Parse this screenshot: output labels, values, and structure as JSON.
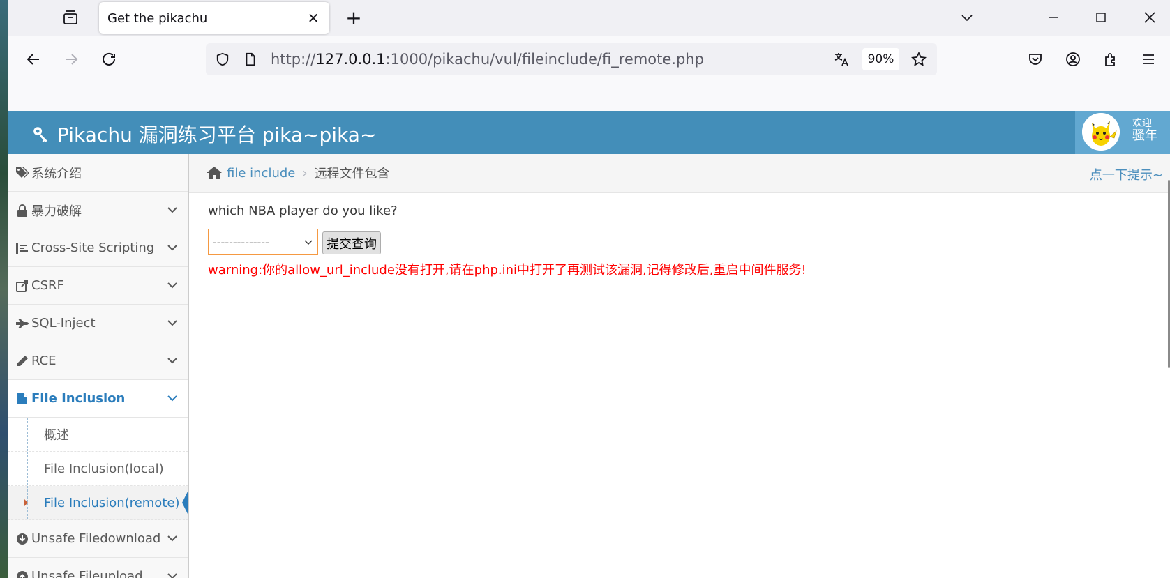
{
  "browser": {
    "tab_title": "Get the pikachu",
    "url_scheme": "http://",
    "url_host": "127.0.0.1",
    "url_path": ":1000/pikachu/vul/fileinclude/fi_remote.php",
    "zoom": "90%"
  },
  "header": {
    "brand": "Pikachu 漏洞练习平台 pika~pika~",
    "welcome": "欢迎",
    "username": "骚年"
  },
  "sidebar": {
    "items": [
      {
        "label": "系统介绍"
      },
      {
        "label": "暴力破解"
      },
      {
        "label": "Cross-Site Scripting"
      },
      {
        "label": "CSRF"
      },
      {
        "label": "SQL-Inject"
      },
      {
        "label": "RCE"
      },
      {
        "label": "File Inclusion"
      },
      {
        "label": "Unsafe Filedownload"
      },
      {
        "label": "Unsafe Fileupload"
      }
    ],
    "subitems": [
      {
        "label": "概述"
      },
      {
        "label": "File Inclusion(local)"
      },
      {
        "label": "File Inclusion(remote)"
      }
    ]
  },
  "breadcrumb": {
    "link": "file include",
    "current": "远程文件包含",
    "hint": "点一下提示~"
  },
  "main": {
    "question": "which NBA player do you like?",
    "select_value": "--------------",
    "submit_label": "提交查询",
    "warning": "warning:你的allow_url_include没有打开,请在php.ini中打开了再测试该漏洞,记得修改后,重启中间件服务!"
  },
  "colors": {
    "header_bg": "#438eb9",
    "accent": "#2b7dbc",
    "warning": "#ff0000"
  }
}
